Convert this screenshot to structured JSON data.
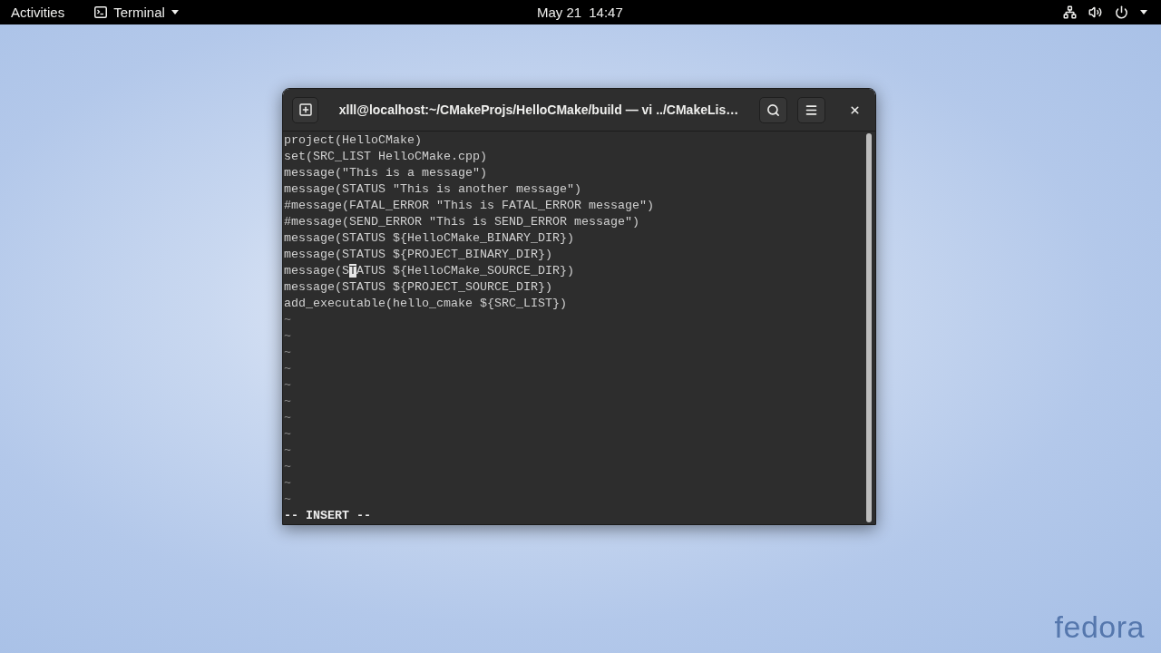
{
  "top_bar": {
    "activities": "Activities",
    "app_menu": {
      "label": "Terminal"
    },
    "date": "May 21",
    "time": "14:47"
  },
  "window": {
    "title": "xlll@localhost:~/CMakeProjs/HelloCMake/build — vi ../CMakeLis…"
  },
  "editor": {
    "lines": [
      {
        "parts": [
          {
            "text": "project(HelloCMake)",
            "cursor": false
          }
        ]
      },
      {
        "parts": [
          {
            "text": "set(SRC_LIST HelloCMake.cpp)",
            "cursor": false
          }
        ]
      },
      {
        "parts": [
          {
            "text": "message(\"This is a message\")",
            "cursor": false
          }
        ]
      },
      {
        "parts": [
          {
            "text": "message(STATUS \"This is another message\")",
            "cursor": false
          }
        ]
      },
      {
        "parts": [
          {
            "text": "#message(FATAL_ERROR \"This is FATAL_ERROR message\")",
            "cursor": false
          }
        ]
      },
      {
        "parts": [
          {
            "text": "#message(SEND_ERROR \"This is SEND_ERROR message\")",
            "cursor": false
          }
        ]
      },
      {
        "parts": [
          {
            "text": "message(STATUS ${HelloCMake_BINARY_DIR})",
            "cursor": false
          }
        ]
      },
      {
        "parts": [
          {
            "text": "message(STATUS ${PROJECT_BINARY_DIR})",
            "cursor": false
          }
        ]
      },
      {
        "parts": [
          {
            "text": "message(S",
            "cursor": false
          },
          {
            "text": "T",
            "cursor": true
          },
          {
            "text": "ATUS ${HelloCMake_SOURCE_DIR})",
            "cursor": false
          }
        ]
      },
      {
        "parts": [
          {
            "text": "message(STATUS ${PROJECT_SOURCE_DIR})",
            "cursor": false
          }
        ]
      },
      {
        "parts": [
          {
            "text": "add_executable(hello_cmake ${SRC_LIST})",
            "cursor": false
          }
        ]
      }
    ],
    "empty_lines": [
      "~",
      "~",
      "~",
      "~",
      "~",
      "~",
      "~",
      "~",
      "~",
      "~",
      "~",
      "~"
    ],
    "status_line": "-- INSERT --"
  },
  "desktop": {
    "logo": "fedora"
  }
}
